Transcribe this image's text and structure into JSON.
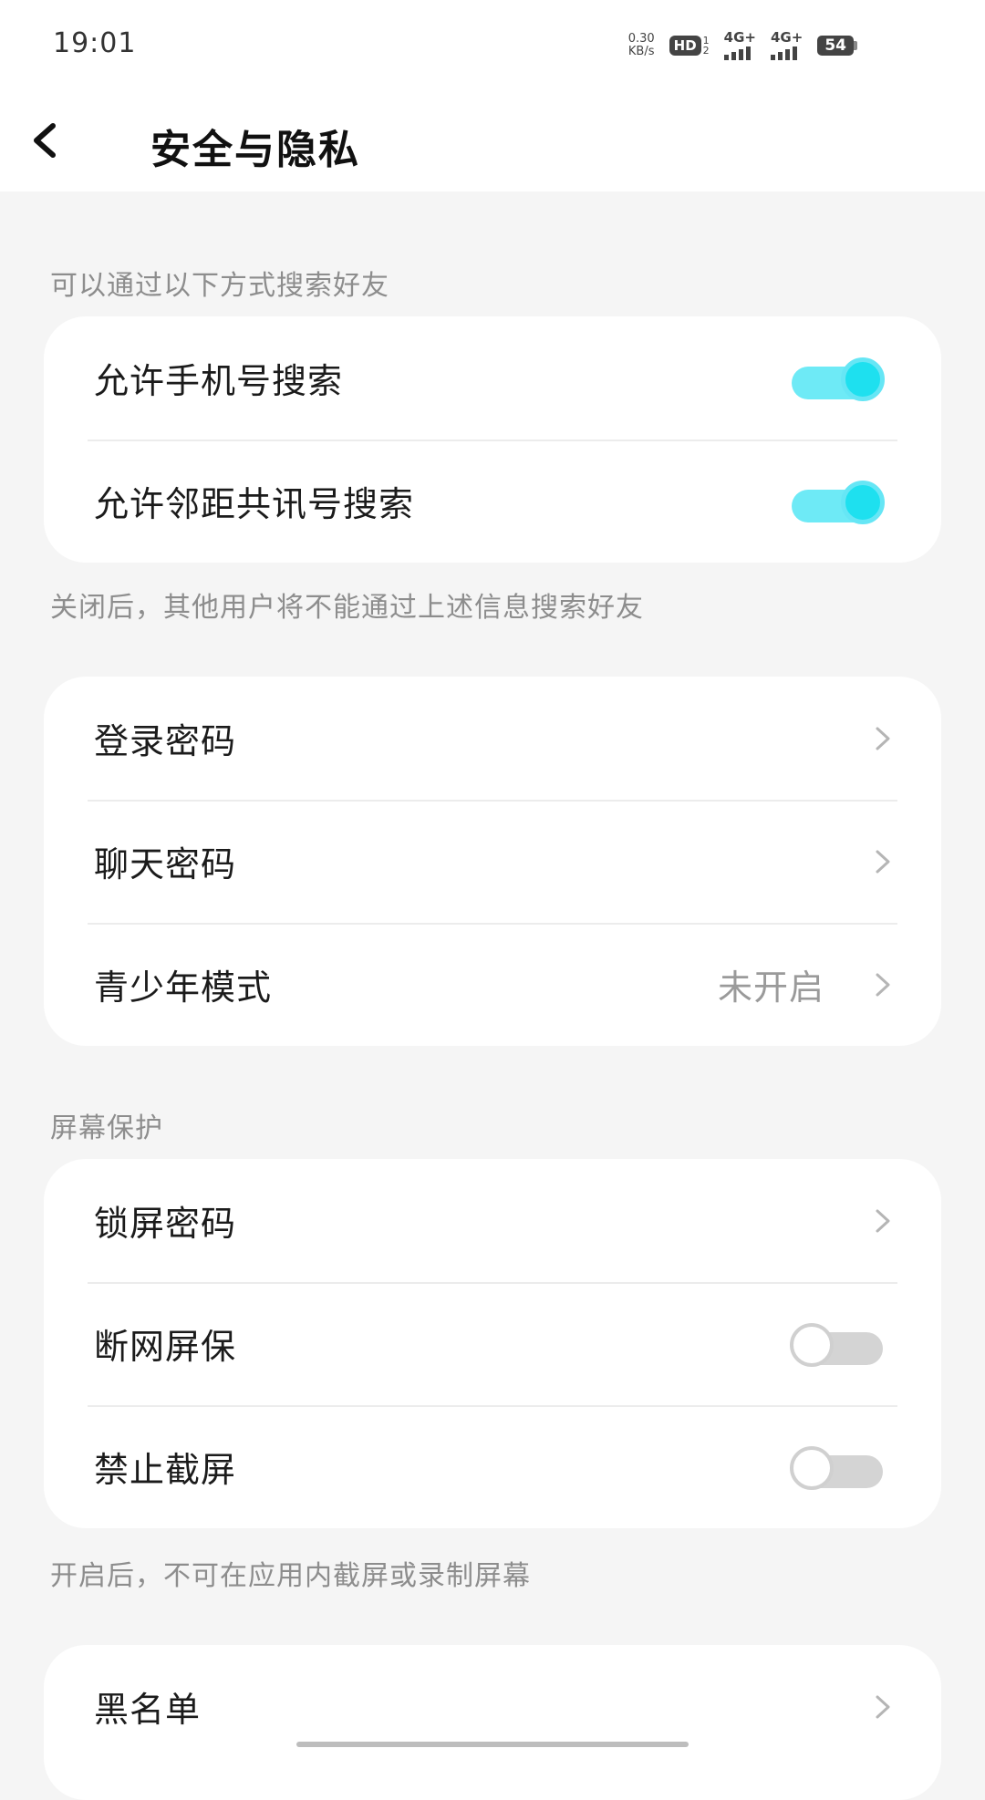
{
  "status_bar": {
    "time": "19:01",
    "net_speed_value": "0.30",
    "net_speed_unit": "KB/s",
    "hd_label": "HD",
    "hd_sub_top": "1",
    "hd_sub_bottom": "2",
    "signal1_label": "4G+",
    "signal2_label": "4G+",
    "battery": "54"
  },
  "header": {
    "title": "安全与隐私"
  },
  "section1": {
    "caption": "可以通过以下方式搜索好友",
    "rows": [
      {
        "label": "允许手机号搜索",
        "toggle": "on"
      },
      {
        "label": "允许邻距共讯号搜索",
        "toggle": "on"
      }
    ],
    "footer": "关闭后，其他用户将不能通过上述信息搜索好友"
  },
  "section2": {
    "rows": [
      {
        "label": "登录密码"
      },
      {
        "label": "聊天密码"
      },
      {
        "label": "青少年模式",
        "value": "未开启"
      }
    ]
  },
  "section3": {
    "caption": "屏幕保护",
    "rows": [
      {
        "label": "锁屏密码"
      },
      {
        "label": "断网屏保",
        "toggle": "off"
      },
      {
        "label": "禁止截屏",
        "toggle": "off"
      }
    ],
    "footer": "开启后，不可在应用内截屏或录制屏幕"
  },
  "section4": {
    "rows": [
      {
        "label": "黑名单"
      }
    ]
  },
  "colors": {
    "accent": "#1ee0ef",
    "background": "#f5f5f5",
    "card": "#ffffff"
  }
}
